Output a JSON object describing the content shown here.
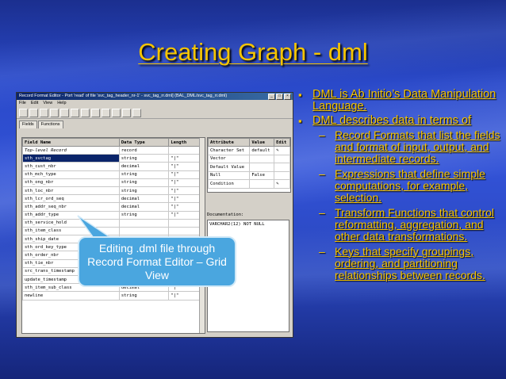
{
  "slide": {
    "title": "Creating Graph - dml",
    "callout": "Editing .dml file through Record Format Editor – Grid View",
    "bullets": [
      {
        "text": "DML is Ab Initio’s Data Manipulation Language.",
        "sub": []
      },
      {
        "text": "DML describes data in terms of",
        "sub": [
          "Record Formats that list the fields and format of input, output, and intermediate records.",
          "Expressions that define simple computations, for example, selection.",
          "Transform Functions that control reformatting, aggregation, and other data transformations.",
          "Keys that specify groupings, ordering, and partitioning relationships between records."
        ]
      }
    ]
  },
  "screenshot": {
    "window_title": "Record Format Editor - Port 'read' of file 'svc_tag_header_nr-1' - svc_tag_rr.dml] (BAL_DML/svc_tag_rr.dml)",
    "menu": [
      "File",
      "Edit",
      "View",
      "Help"
    ],
    "tabs": [
      "Fields",
      "Functions"
    ],
    "grid_headers": [
      "Field Name",
      "Data Type",
      "Length"
    ],
    "grid_rows": [
      {
        "name": "Top-level Record",
        "type": "record",
        "len": ""
      },
      {
        "name": "sth_svctag",
        "type": "string",
        "len": "\"|\""
      },
      {
        "name": "sth_cust_nbr",
        "type": "decimal",
        "len": "\"|\""
      },
      {
        "name": "sth_mch_type",
        "type": "string",
        "len": "\"|\""
      },
      {
        "name": "sth_ong_nbr",
        "type": "string",
        "len": "\"|\""
      },
      {
        "name": "sth_loc_nbr",
        "type": "string",
        "len": "\"|\""
      },
      {
        "name": "sth_lcr_ord_seq",
        "type": "decimal",
        "len": "\"|\""
      },
      {
        "name": "sth_addr_seq_nbr",
        "type": "decimal",
        "len": "\"|\""
      },
      {
        "name": "sth_addr_type",
        "type": "string",
        "len": "\"|\""
      },
      {
        "name": "sth_service_hold",
        "type": "",
        "len": ""
      },
      {
        "name": "sth_item_class",
        "type": "",
        "len": ""
      },
      {
        "name": "sth_ship_date",
        "type": "",
        "len": ""
      },
      {
        "name": "sth_ord_key_type",
        "type": "",
        "len": ""
      },
      {
        "name": "sth_order_nbr",
        "type": "",
        "len": ""
      },
      {
        "name": "sth_tie_nbr",
        "type": "",
        "len": ""
      },
      {
        "name": "src_trans_timestamp",
        "type": "datetime",
        "len": "\"|\""
      },
      {
        "name": "update_timestamp",
        "type": "datetime",
        "len": "\"|\""
      },
      {
        "name": "sth_item_sub_class",
        "type": "decimal",
        "len": "\"|\""
      },
      {
        "name": "newline",
        "type": "string",
        "len": "\"|\""
      }
    ],
    "attr_headers": [
      "Attribute",
      "Value",
      "Edit"
    ],
    "attr_rows": [
      {
        "attr": "Character Set",
        "value": "default"
      },
      {
        "attr": "Vector",
        "value": ""
      },
      {
        "attr": "Default Value",
        "value": ""
      },
      {
        "attr": "Null",
        "value": "False"
      },
      {
        "attr": "Condition",
        "value": ""
      }
    ],
    "doc_label": "Documentation:",
    "doc_text": "VARCHAR2(12) NOT NULL"
  },
  "colors": {
    "bullet_text": "#f5c400",
    "background": "#2a49c9",
    "callout_fill": "#4aa6df"
  }
}
